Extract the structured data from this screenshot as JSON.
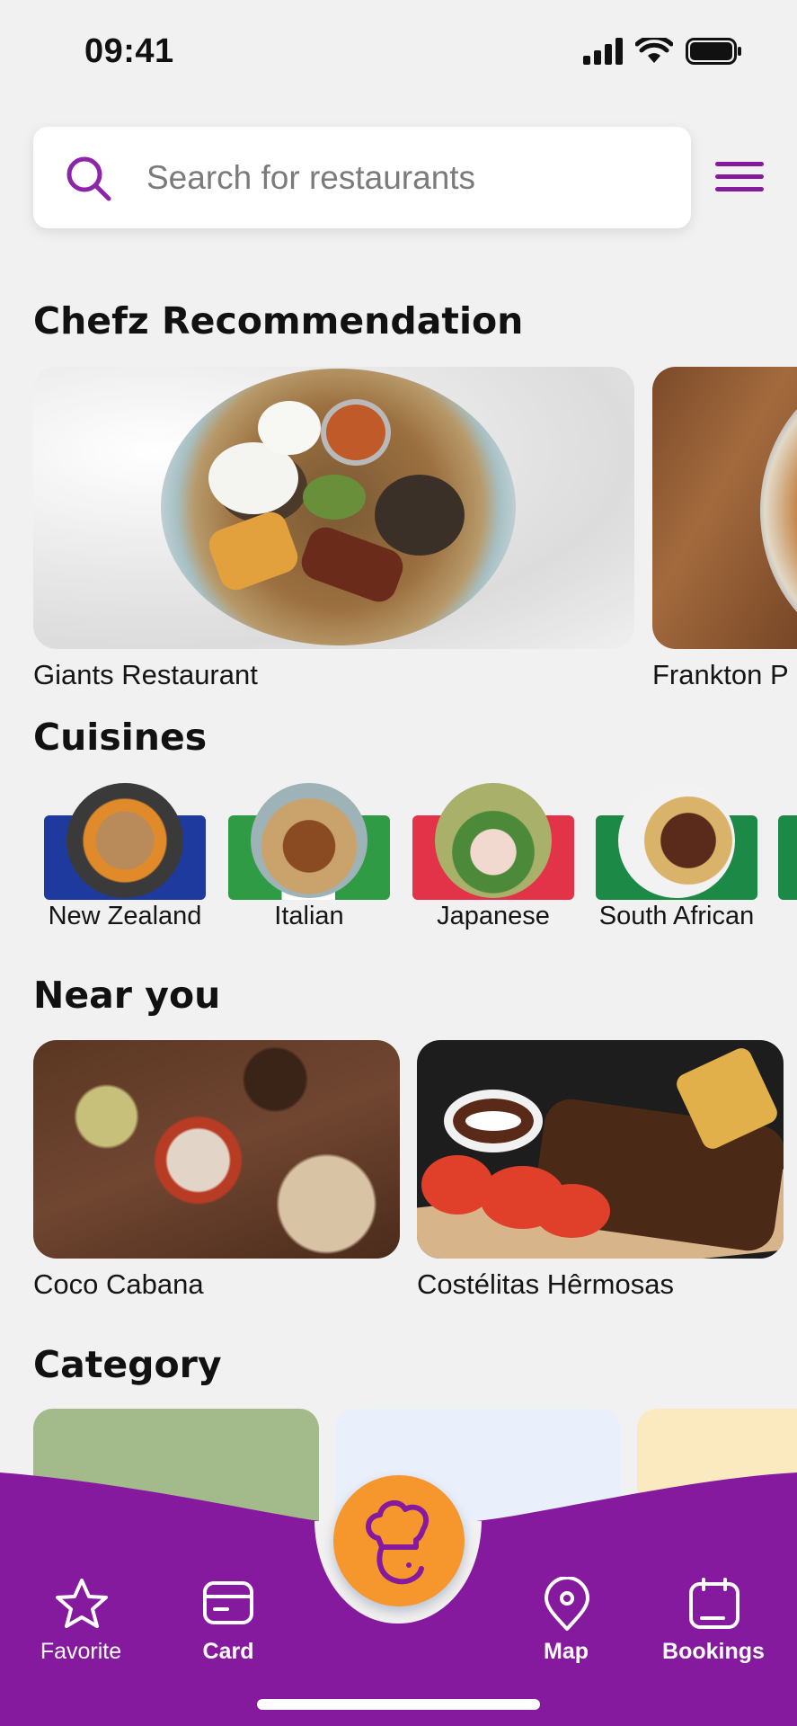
{
  "status_bar": {
    "time": "09:41"
  },
  "search": {
    "placeholder": "Search for restaurants"
  },
  "sections": {
    "recommendation_title": "Chefz Recommendation",
    "cuisines_title": "Cuisines",
    "near_title": "Near you",
    "category_title": "Category"
  },
  "recommendations": [
    {
      "name": "Giants Restaurant"
    },
    {
      "name": "Frankton P"
    }
  ],
  "cuisines": [
    {
      "label": "New Zealand",
      "flag_color": "#1f3a9e"
    },
    {
      "label": "Italian",
      "flag_color": "#2f9b45"
    },
    {
      "label": "Japanese",
      "flag_color": "#e23349"
    },
    {
      "label": "South African",
      "flag_color": "#1c8a46"
    }
  ],
  "near_you": [
    {
      "name": "Coco Cabana"
    },
    {
      "name": "Costélitas Hêrmosas"
    }
  ],
  "categories": [
    {
      "color": "#a3ba8a"
    },
    {
      "color": "#eaf0fb"
    },
    {
      "color": "#fbe9bf"
    }
  ],
  "bottom_nav": {
    "favorite": "Favorite",
    "card": "Card",
    "map": "Map",
    "bookings": "Bookings"
  },
  "colors": {
    "brand_purple": "#861a9e",
    "accent_orange": "#f6972e",
    "background": "#f2f1f2"
  },
  "icons": [
    "search-icon",
    "menu-icon",
    "star-icon",
    "card-icon",
    "chef-icon",
    "map-pin-icon",
    "calendar-icon"
  ]
}
